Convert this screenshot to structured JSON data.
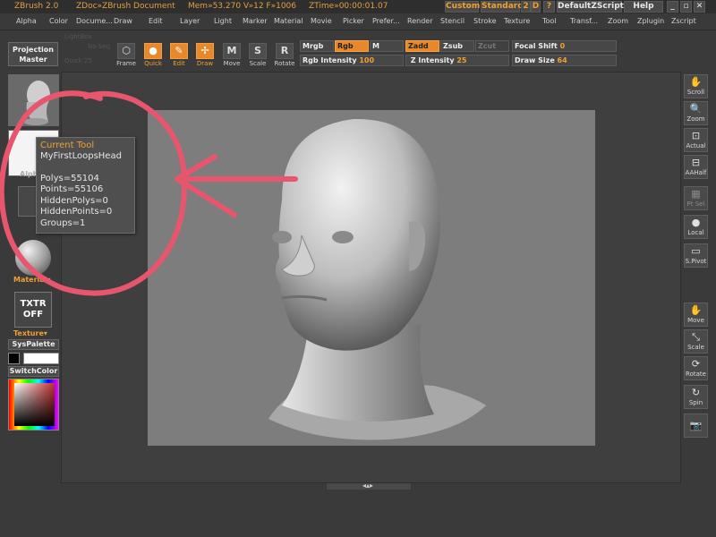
{
  "titlebar": {
    "app": "ZBrush 2.0",
    "doc": "ZDoc»ZBrush Document",
    "mem": "Mem»53.270 V»12 F»1006",
    "ztime": "ZTime»00:00:01.07",
    "custom_btn": "Custom",
    "standard_btn": "Standard",
    "z_btn": "2",
    "d_btn": "D",
    "q_btn": "?",
    "default_zscript_btn": "DefaultZScript",
    "help_btn": "Help"
  },
  "menu": [
    "Alpha",
    "Color",
    "Docume...",
    "Draw",
    "Edit",
    "Layer",
    "Light",
    "Marker",
    "Material",
    "Movie",
    "Picker",
    "Prefer...",
    "Render",
    "Stencil",
    "Stroke",
    "Texture",
    "Tool",
    "Transf...",
    "Zoom",
    "Zplugin",
    "Zscript"
  ],
  "toolbar": {
    "projection_master": [
      "Projection",
      "Master"
    ],
    "ghost_items": [
      "LightBox",
      "No Seq",
      "Quick 25",
      "Local"
    ],
    "tools": [
      {
        "label": "Frame",
        "glyph": "⬡",
        "active": false
      },
      {
        "label": "Quick",
        "glyph": "●",
        "active": true
      },
      {
        "label": "Edit",
        "glyph": "✎",
        "active": true
      },
      {
        "label": "Draw",
        "glyph": "✢",
        "active": true
      },
      {
        "label": "Move",
        "glyph": "M",
        "active": false
      },
      {
        "label": "Scale",
        "glyph": "S",
        "active": false
      },
      {
        "label": "Rotate",
        "glyph": "R",
        "active": false
      }
    ],
    "mrgb": "Mrgb",
    "rgb": "Rgb",
    "m": "M",
    "zadd": "Zadd",
    "zsub": "Zsub",
    "zcut": "Zcut",
    "rgb_intensity_label": "Rgb Intensity",
    "rgb_intensity_value": "100",
    "z_intensity_label": "Z Intensity",
    "z_intensity_value": "25",
    "focal_shift_label": "Focal Shift",
    "focal_shift_value": "0",
    "draw_size_label": "Draw Size",
    "draw_size_value": "64"
  },
  "leftpanel": {
    "alpha_label": "Alpha",
    "material_label": "Material",
    "txtr": [
      "TXTR",
      "OFF"
    ],
    "texture_label": "Texture",
    "syspalette": "SysPalette",
    "switchcolor": "SwitchColor"
  },
  "tooltip": {
    "title": "Current Tool",
    "name": "MyFirstLoopsHead",
    "polys": "Polys=55104",
    "points": "Points=55106",
    "hidden_polys": "HiddenPolys=0",
    "hidden_points": "HiddenPoints=0",
    "groups": "Groups=1"
  },
  "rightpanel": [
    {
      "label": "Scroll",
      "icon": "hand-icon",
      "glyph": "✋",
      "dim": false
    },
    {
      "label": "Zoom",
      "icon": "zoom-icon",
      "glyph": "🔍",
      "dim": false
    },
    {
      "label": "Actual",
      "icon": "actual-icon",
      "glyph": "⊡",
      "dim": false
    },
    {
      "label": "AAHalf",
      "icon": "aahalf-icon",
      "glyph": "⊟",
      "dim": false
    },
    {
      "label": "Pt Sel",
      "icon": "grid-icon",
      "glyph": "▦",
      "dim": true
    },
    {
      "label": "Local",
      "icon": "local-icon",
      "glyph": "●",
      "dim": false
    },
    {
      "label": "S.Pivot",
      "icon": "pivot-icon",
      "glyph": "▭",
      "dim": false
    },
    {
      "label": "Move",
      "icon": "move-icon",
      "glyph": "✋",
      "dim": false
    },
    {
      "label": "Scale",
      "icon": "scale-icon",
      "glyph": "⤡",
      "dim": false
    },
    {
      "label": "Rotate",
      "icon": "rotate-icon",
      "glyph": "⟳",
      "dim": false
    },
    {
      "label": "Spin",
      "icon": "spin-icon",
      "glyph": "↻",
      "dim": false
    },
    {
      "label": "",
      "icon": "camera-icon",
      "glyph": "📷",
      "dim": false
    }
  ],
  "colors": {
    "accent": "#e8882a",
    "annotation": "#e8566e",
    "canvas": "#7d7d7d"
  }
}
